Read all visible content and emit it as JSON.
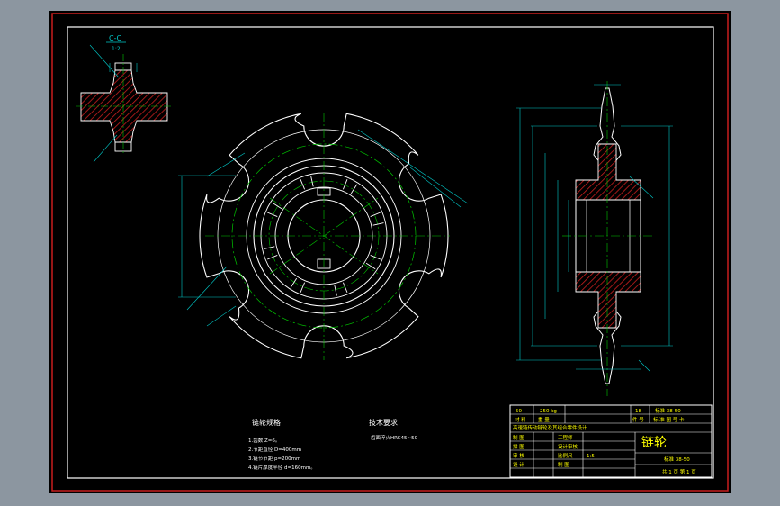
{
  "colors": {
    "frame_bg": "#000000",
    "outer_border": "#c81e1e",
    "inner_border": "#ffffff",
    "outline": "#ffffff",
    "centerline": "#00c800",
    "dimension": "#00c8c8",
    "hatch": "#c81e1e",
    "table_text": "#ffff00",
    "window_bg": "#8c96a0"
  },
  "section_view": {
    "label": "C-C",
    "scale": "1:2"
  },
  "title_block": {
    "row1": [
      "50",
      "250 kg",
      "18",
      "标准 38-50"
    ],
    "row2": [
      "材 料",
      "重 量",
      "件 号",
      "标 准 图 号 卡"
    ],
    "design_title": "高速链传动链轮及其组合零件设计",
    "part_name": "链轮",
    "rows": [
      {
        "role": "制 图",
        "tag": "工程师"
      },
      {
        "role": "描 图",
        "tag": "设计审核"
      },
      {
        "role": "审 核",
        "tag": "比例尺",
        "value": "1:5"
      },
      {
        "role": "设 计",
        "tag": "制 图"
      }
    ],
    "drawing_no": "标准 38-50",
    "sheet": "共 1 页  第 1 页"
  },
  "specs": {
    "title": "链轮规格",
    "items": [
      "1.齿数 Z=6。",
      "2.节距直径 D=400mm",
      "3.链节节距 p=200mm",
      "4.链片厚度半径 d=160mm。"
    ]
  },
  "tech": {
    "title": "技术要求",
    "items": [
      "齿面淬火HRC45~50"
    ]
  }
}
